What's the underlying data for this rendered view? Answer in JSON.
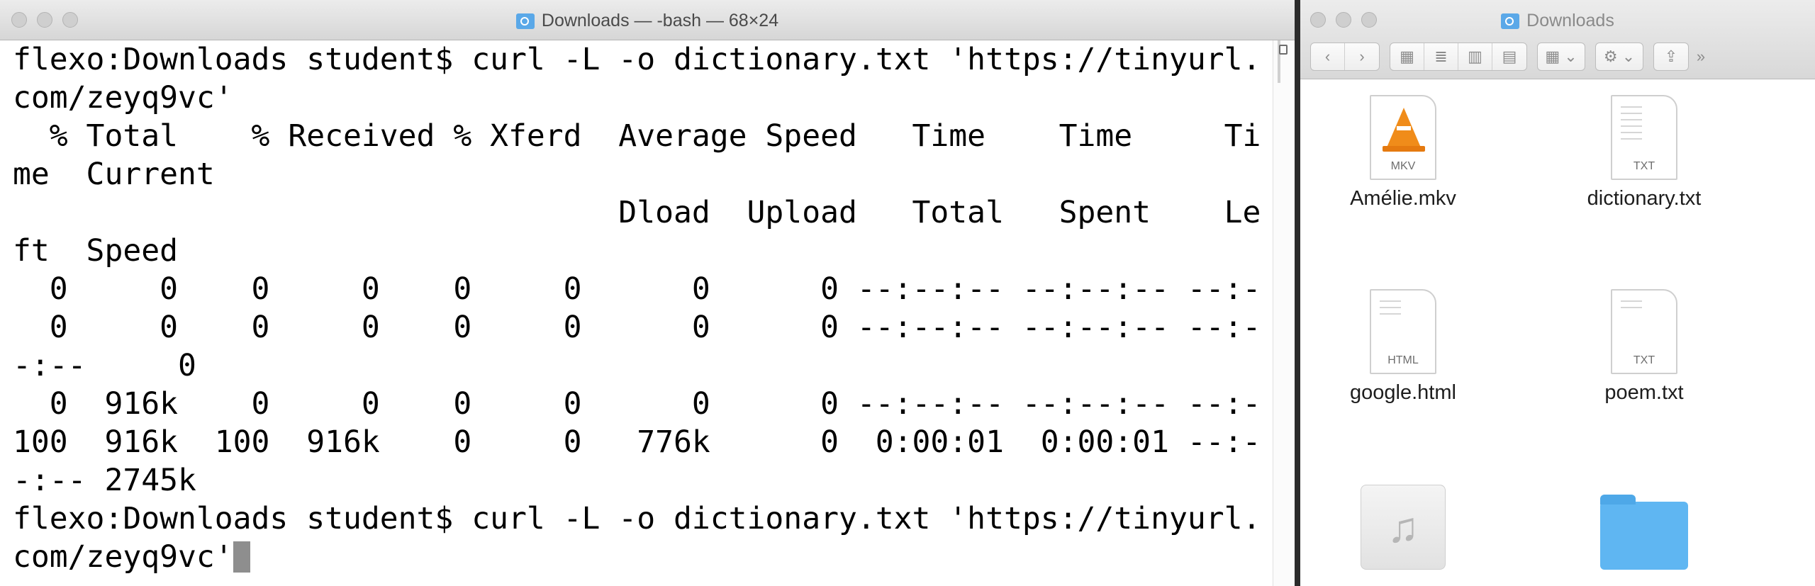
{
  "terminal": {
    "title": "Downloads — -bash — 68×24",
    "lines": [
      "flexo:Downloads student$ curl -L -o dictionary.txt 'https://tinyurl.",
      "com/zeyq9vc'",
      "  % Total    % Received % Xferd  Average Speed   Time    Time     Ti",
      "me  Current",
      "                                 Dload  Upload   Total   Spent    Le",
      "ft  Speed",
      "  0     0    0     0    0     0      0      0 --:--:-- --:--:-- --:-",
      "  0     0    0     0    0     0      0      0 --:--:-- --:--:-- --:-",
      "-:--     0",
      "  0  916k    0     0    0     0      0      0 --:--:-- --:--:-- --:-",
      "100  916k  100  916k    0     0   776k      0  0:00:01  0:00:01 --:-",
      "-:-- 2745k",
      "flexo:Downloads student$ curl -L -o dictionary.txt 'https://tinyurl.",
      "com/zeyq9vc'"
    ]
  },
  "finder": {
    "title": "Downloads",
    "toolbar": {
      "back": "‹",
      "forward": "›",
      "view_icons": "▦",
      "view_list": "≣",
      "view_columns": "▥",
      "view_cover": "▤",
      "arrange": "▦ ⌄",
      "action": "⚙ ⌄",
      "share": "⇪",
      "more": "»"
    },
    "files": [
      {
        "name": "Amélie.mkv",
        "tag": "MKV",
        "icon": "vlc-cone-icon"
      },
      {
        "name": "dictionary.txt",
        "tag": "TXT",
        "icon": "text-document-icon"
      },
      {
        "name": "google.html",
        "tag": "HTML",
        "icon": "html-document-icon"
      },
      {
        "name": "poem.txt",
        "tag": "TXT",
        "icon": "text-document-icon"
      },
      {
        "name": "",
        "tag": "",
        "icon": "music-file-icon",
        "glyph": "♫"
      },
      {
        "name": "",
        "tag": "",
        "icon": "folder-icon"
      }
    ]
  }
}
